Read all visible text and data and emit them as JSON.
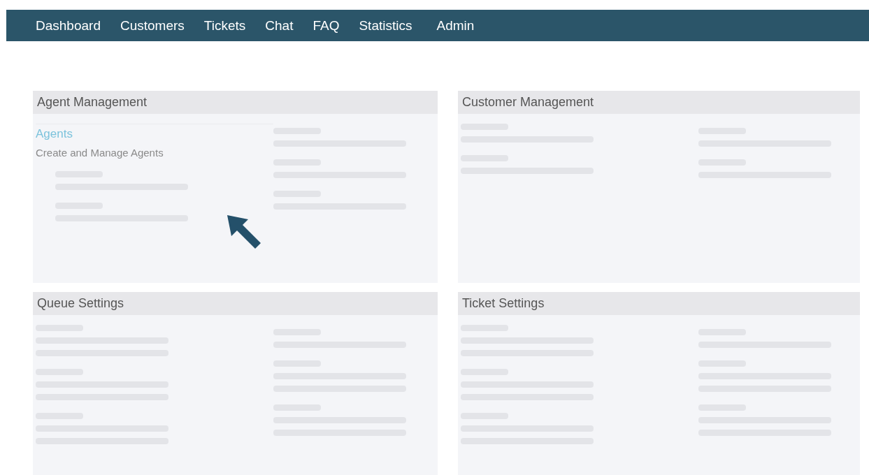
{
  "nav": [
    {
      "label": "Dashboard"
    },
    {
      "label": "Customers"
    },
    {
      "label": "Tickets"
    },
    {
      "label": "Chat"
    },
    {
      "label": "FAQ"
    },
    {
      "label": "Statistics"
    },
    {
      "label": "Admin"
    }
  ],
  "panels": [
    {
      "title": "Agent Management",
      "link": "Agents",
      "description": "Create and Manage Agents",
      "cursor": true
    },
    {
      "title": "Customer Management"
    },
    {
      "title": "Queue Settings"
    },
    {
      "title": "Ticket Settings"
    }
  ]
}
